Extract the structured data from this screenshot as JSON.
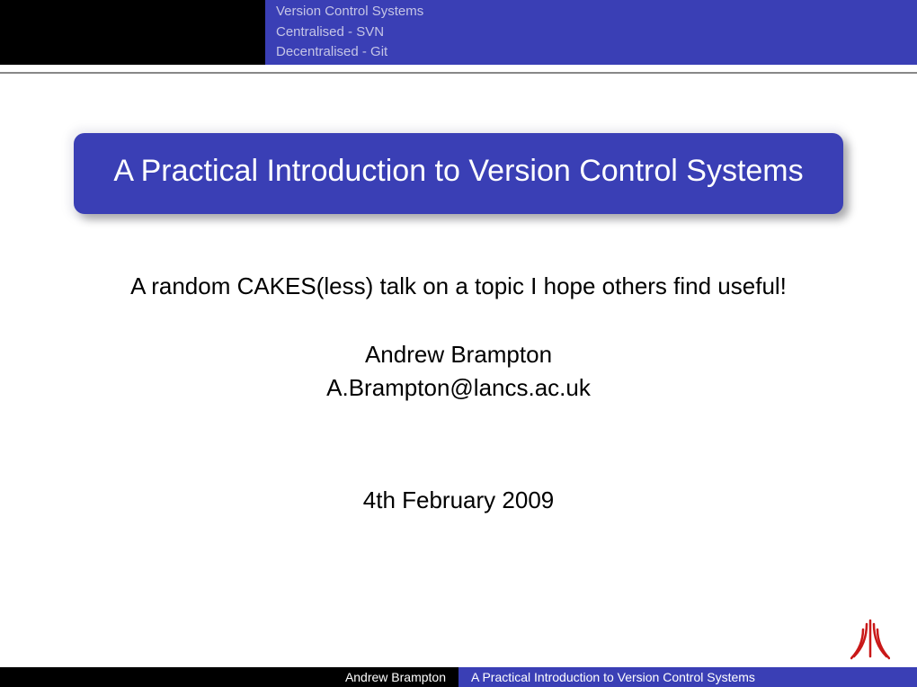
{
  "header": {
    "nav_items": [
      "Version Control Systems",
      "Centralised - SVN",
      "Decentralised - Git"
    ]
  },
  "title": "A Practical Introduction to Version Control Systems",
  "subtitle": "A random CAKES(less) talk on a topic I hope others find useful!",
  "author_name": "Andrew Brampton",
  "author_email": "A.Brampton@lancs.ac.uk",
  "date": "4th February 2009",
  "footer": {
    "author": "Andrew Brampton",
    "title": "A Practical Introduction to Version Control Systems"
  }
}
